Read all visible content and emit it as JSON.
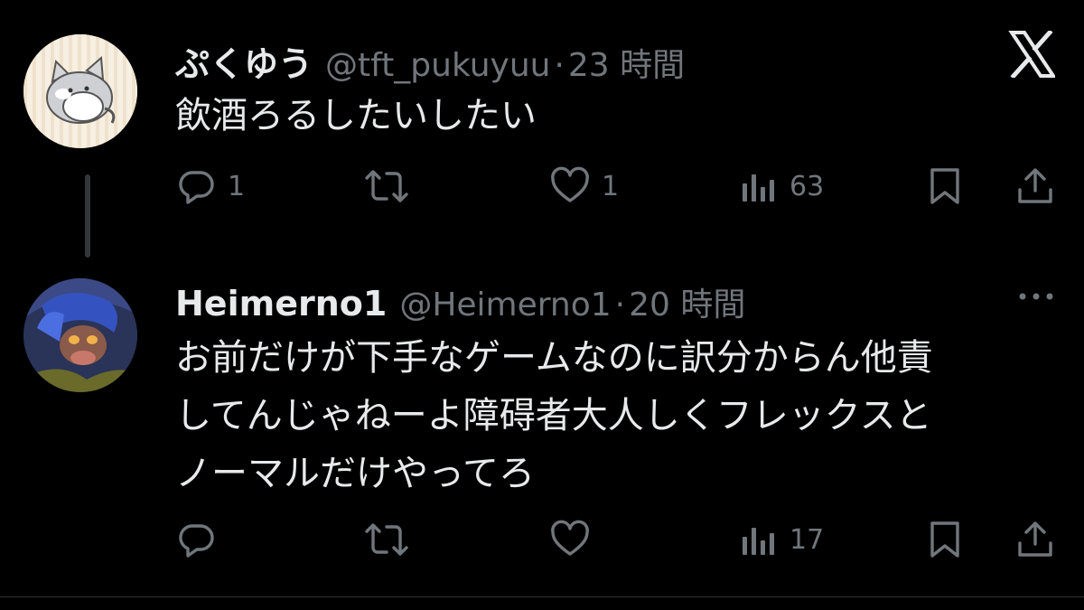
{
  "tweets": [
    {
      "name": "ぷくゆう",
      "handle": "@tft_pukuyuu",
      "separator": "·",
      "time": "23 時間",
      "lines": [
        "飲酒ろるしたいしたい"
      ],
      "actions": {
        "replies": "1",
        "retweets": "",
        "likes": "1",
        "views": "63"
      }
    },
    {
      "name": "Heimerno1",
      "handle": "@Heimerno1",
      "separator": "·",
      "time": "20 時間",
      "lines": [
        "お前だけが下手なゲームなのに訳分からん他責",
        "してんじゃねーよ障碍者大人しくフレックスと",
        "ノーマルだけやってろ"
      ],
      "actions": {
        "replies": "",
        "retweets": "",
        "likes": "",
        "views": "17"
      }
    }
  ],
  "icons": {
    "top_right": "x-logo-icon",
    "more": "more-options-icon",
    "reply": "reply-icon",
    "retweet": "retweet-icon",
    "like": "heart-icon",
    "views": "views-chart-icon",
    "bookmark": "bookmark-icon",
    "share": "share-icon"
  },
  "colors": {
    "background": "#000000",
    "text": "#e7e9ea",
    "secondary": "#71767b"
  }
}
